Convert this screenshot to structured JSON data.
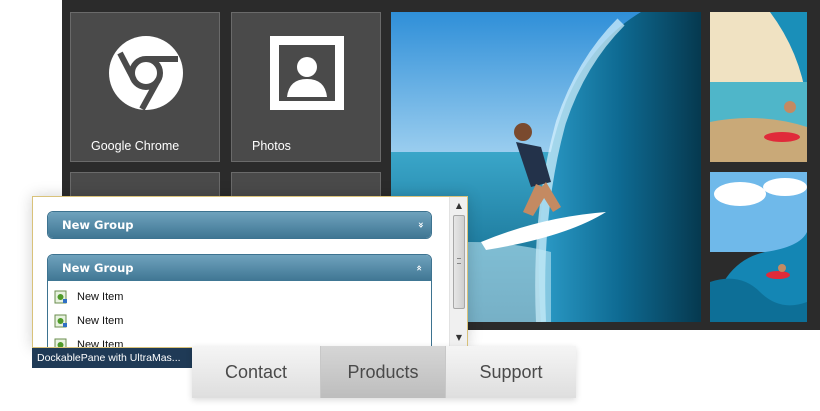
{
  "tiles": [
    {
      "label": "Google Chrome",
      "icon": "chrome-icon"
    },
    {
      "label": "Photos",
      "icon": "photos-icon"
    }
  ],
  "dock": {
    "groups": [
      {
        "title": "New Group",
        "state": "collapsed",
        "chevron": "»"
      },
      {
        "title": "New Group",
        "state": "expanded",
        "chevron": "»",
        "items": [
          "New Item",
          "New Item",
          "New Item"
        ]
      }
    ],
    "caption": "DockablePane with UltraMas..."
  },
  "menu": {
    "items": [
      "Contact",
      "Products",
      "Support"
    ],
    "selected": "Products"
  },
  "colors": {
    "desktop_bg": "#2b2b2b",
    "tile_bg": "#4a4a4a",
    "group_header": "#4f86a4",
    "caption_bg": "#1f3a56"
  }
}
